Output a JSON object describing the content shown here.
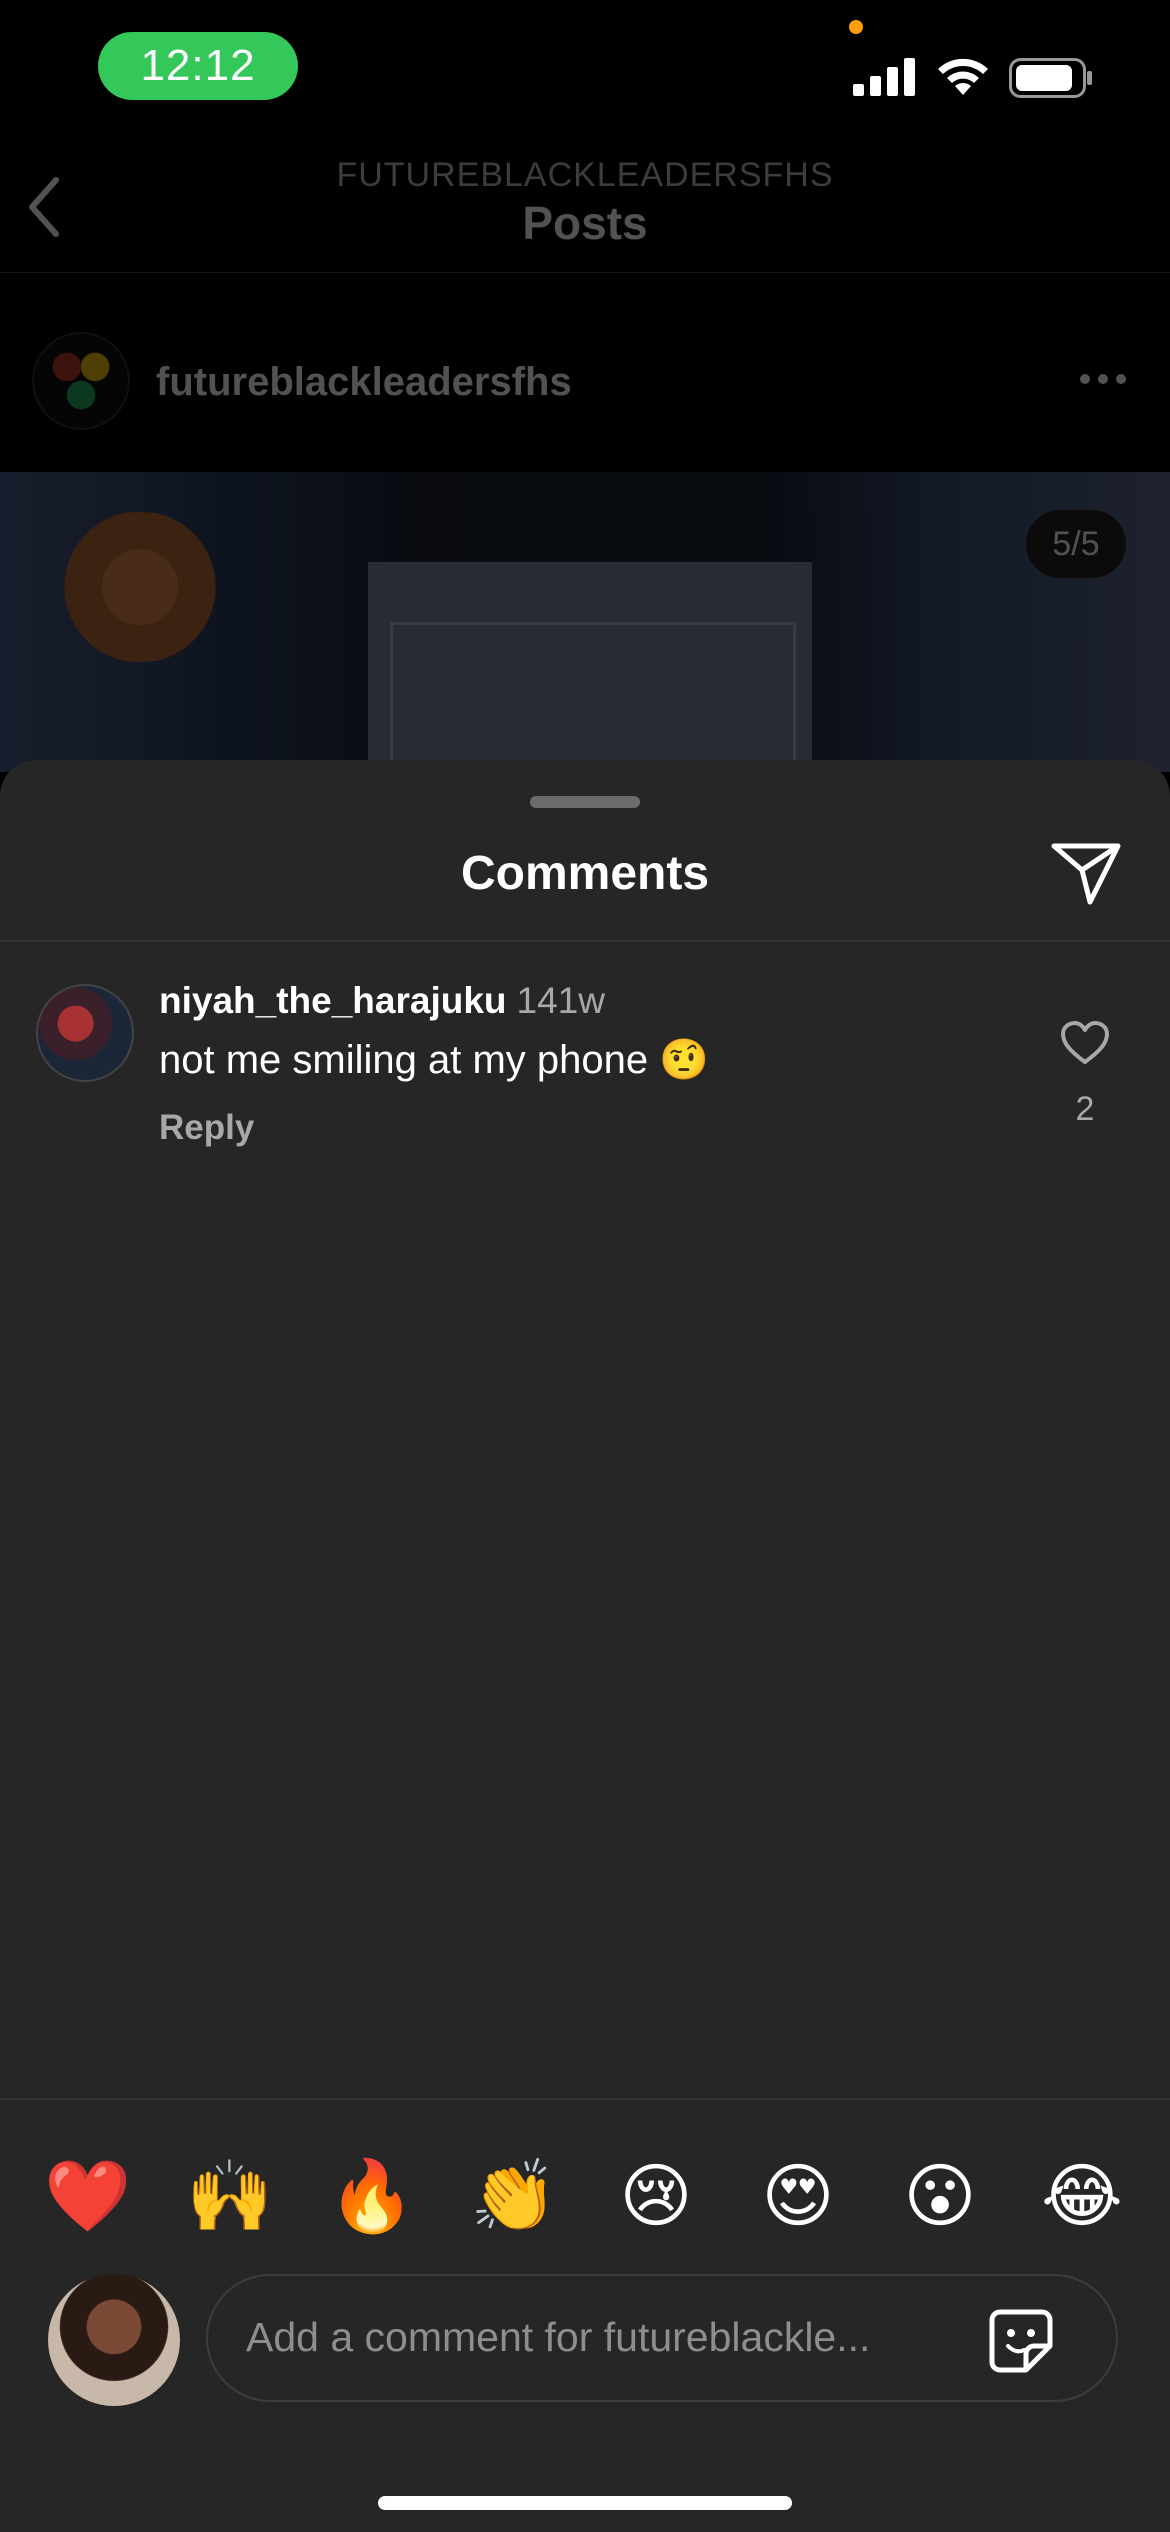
{
  "status_bar": {
    "time": "12:12"
  },
  "header": {
    "account_caps": "FUTUREBLACKLEADERSFHS",
    "title": "Posts"
  },
  "post": {
    "username": "futureblackleadersfhs",
    "image_counter": "5/5"
  },
  "sheet": {
    "title": "Comments"
  },
  "comments": [
    {
      "username": "niyah_the_harajuku",
      "time": "141w",
      "text": "not me smiling at my phone 🤨",
      "reply_label": "Reply",
      "likes": "2"
    }
  ],
  "emoji_bar": [
    "❤️",
    "🙌",
    "🔥",
    "👏",
    "😢",
    "😍",
    "😮",
    "😂"
  ],
  "composer": {
    "placeholder": "Add a comment for futureblackle..."
  },
  "colors": {
    "status_pill": "#34c759",
    "sheet_bg": "#262626",
    "secondary_text": "#a8a8a8"
  },
  "icons": [
    "back-chevron-icon",
    "more-icon",
    "share-icon",
    "heart-icon",
    "sticker-icon",
    "signal-icon",
    "wifi-icon",
    "battery-icon"
  ]
}
